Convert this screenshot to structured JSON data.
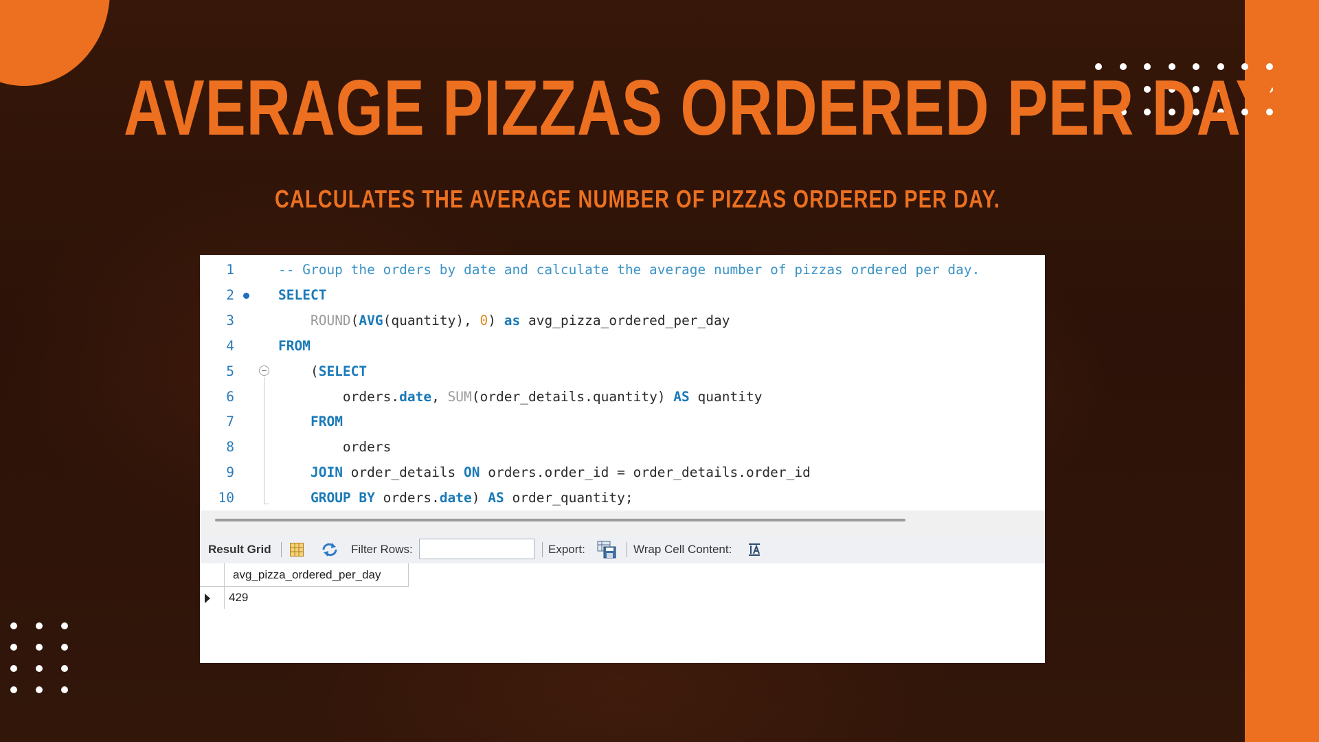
{
  "slide": {
    "title": "AVERAGE PIZZAS ORDERED PER DAY",
    "subtitle": "CALCULATES THE AVERAGE NUMBER OF PIZZAS ORDERED PER DAY.",
    "colors": {
      "accent": "#ec7020",
      "background": "#2a1208"
    }
  },
  "editor": {
    "lines": [
      {
        "num": "1",
        "tokens": [
          {
            "t": "-- Group the orders by date and calculate the average number of pizzas ordered per day.",
            "c": "cm"
          }
        ]
      },
      {
        "num": "2",
        "tokens": [
          {
            "t": "SELECT",
            "c": "kw"
          }
        ]
      },
      {
        "num": "3",
        "tokens": [
          {
            "t": "    ",
            "c": "id"
          },
          {
            "t": "ROUND",
            "c": "fn"
          },
          {
            "t": "(",
            "c": "id"
          },
          {
            "t": "AVG",
            "c": "kw"
          },
          {
            "t": "(quantity), ",
            "c": "id"
          },
          {
            "t": "0",
            "c": "num"
          },
          {
            "t": ") ",
            "c": "id"
          },
          {
            "t": "as",
            "c": "kw"
          },
          {
            "t": " avg_pizza_ordered_per_day",
            "c": "id"
          }
        ]
      },
      {
        "num": "4",
        "tokens": [
          {
            "t": "FROM",
            "c": "kw"
          }
        ]
      },
      {
        "num": "5",
        "tokens": [
          {
            "t": "    (",
            "c": "id"
          },
          {
            "t": "SELECT",
            "c": "kw"
          }
        ]
      },
      {
        "num": "6",
        "tokens": [
          {
            "t": "        orders.",
            "c": "id"
          },
          {
            "t": "date",
            "c": "kw"
          },
          {
            "t": ", ",
            "c": "id"
          },
          {
            "t": "SUM",
            "c": "fn"
          },
          {
            "t": "(order_details.quantity) ",
            "c": "id"
          },
          {
            "t": "AS",
            "c": "kw"
          },
          {
            "t": " quantity",
            "c": "id"
          }
        ]
      },
      {
        "num": "7",
        "tokens": [
          {
            "t": "    ",
            "c": "id"
          },
          {
            "t": "FROM",
            "c": "kw"
          }
        ]
      },
      {
        "num": "8",
        "tokens": [
          {
            "t": "        orders",
            "c": "id"
          }
        ]
      },
      {
        "num": "9",
        "tokens": [
          {
            "t": "    ",
            "c": "id"
          },
          {
            "t": "JOIN",
            "c": "kw"
          },
          {
            "t": " order_details ",
            "c": "id"
          },
          {
            "t": "ON",
            "c": "kw"
          },
          {
            "t": " orders.order_id = order_details.order_id",
            "c": "id"
          }
        ]
      },
      {
        "num": "10",
        "tokens": [
          {
            "t": "    ",
            "c": "id"
          },
          {
            "t": "GROUP BY",
            "c": "kw"
          },
          {
            "t": " orders.",
            "c": "id"
          },
          {
            "t": "date",
            "c": "kw"
          },
          {
            "t": ") ",
            "c": "id"
          },
          {
            "t": "AS",
            "c": "kw"
          },
          {
            "t": " order_quantity;",
            "c": "id"
          }
        ]
      }
    ]
  },
  "toolbar": {
    "result_grid_label": "Result Grid",
    "filter_rows_label": "Filter Rows:",
    "filter_rows_value": "",
    "export_label": "Export:",
    "wrap_cell_label": "Wrap Cell Content:"
  },
  "result_grid": {
    "columns": [
      "avg_pizza_ordered_per_day"
    ],
    "rows": [
      [
        "429"
      ]
    ]
  }
}
